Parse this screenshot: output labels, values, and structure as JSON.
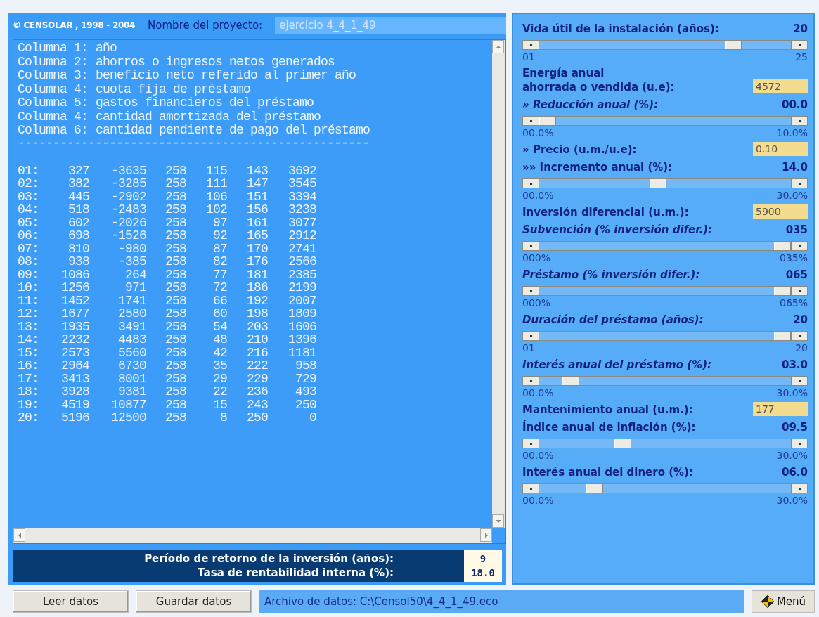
{
  "header": {
    "copyright": "© CENSOLAR , 1998 - 2004",
    "project_label": "Nombre del proyecto:",
    "project_name": "ejercicio 4_4_1_49"
  },
  "output": {
    "legend": [
      {
        "column": "Columna 1:",
        "text": "año"
      },
      {
        "column": "Columna 2:",
        "text": "ahorros o ingresos netos generados"
      },
      {
        "column": "Columna 3:",
        "text": "beneficio neto referido al primer año"
      },
      {
        "column": "Columna 4:",
        "text": "cuota fija de préstamo"
      },
      {
        "column": "Columna 5:",
        "text": "gastos financieros del préstamo"
      },
      {
        "column": "Columna 4:",
        "text": "cantidad amortizada del préstamo"
      },
      {
        "column": "Columna 6:",
        "text": "cantidad pendiente de pago del préstamo"
      }
    ],
    "separator": "--------------------------------------------------",
    "rows": [
      [
        "01:",
        "327",
        "-3635",
        "258",
        "115",
        "143",
        "3692"
      ],
      [
        "02:",
        "382",
        "-3285",
        "258",
        "111",
        "147",
        "3545"
      ],
      [
        "03:",
        "445",
        "-2902",
        "258",
        "106",
        "151",
        "3394"
      ],
      [
        "04:",
        "518",
        "-2483",
        "258",
        "102",
        "156",
        "3238"
      ],
      [
        "05:",
        "602",
        "-2026",
        "258",
        "97",
        "161",
        "3077"
      ],
      [
        "06:",
        "698",
        "-1526",
        "258",
        "92",
        "165",
        "2912"
      ],
      [
        "07:",
        "810",
        "-980",
        "258",
        "87",
        "170",
        "2741"
      ],
      [
        "08:",
        "938",
        "-385",
        "258",
        "82",
        "176",
        "2566"
      ],
      [
        "09:",
        "1086",
        "264",
        "258",
        "77",
        "181",
        "2385"
      ],
      [
        "10:",
        "1256",
        "971",
        "258",
        "72",
        "186",
        "2199"
      ],
      [
        "11:",
        "1452",
        "1741",
        "258",
        "66",
        "192",
        "2007"
      ],
      [
        "12:",
        "1677",
        "2580",
        "258",
        "60",
        "198",
        "1809"
      ],
      [
        "13:",
        "1935",
        "3491",
        "258",
        "54",
        "203",
        "1606"
      ],
      [
        "14:",
        "2232",
        "4483",
        "258",
        "48",
        "210",
        "1396"
      ],
      [
        "15:",
        "2573",
        "5560",
        "258",
        "42",
        "216",
        "1181"
      ],
      [
        "16:",
        "2964",
        "6730",
        "258",
        "35",
        "222",
        "958"
      ],
      [
        "17:",
        "3413",
        "8001",
        "258",
        "29",
        "229",
        "729"
      ],
      [
        "18:",
        "3928",
        "9381",
        "258",
        "22",
        "236",
        "493"
      ],
      [
        "19:",
        "4519",
        "10877",
        "258",
        "15",
        "243",
        "250"
      ],
      [
        "20:",
        "5196",
        "12500",
        "258",
        "8",
        "250",
        "0"
      ]
    ]
  },
  "results": [
    {
      "label": "Período de retorno de la inversión (años):",
      "value": "9"
    },
    {
      "label": "Tasa de rentabilidad interna (%):",
      "value": "18.0"
    }
  ],
  "parameters": [
    {
      "kind": "slider",
      "label": "Vida útil de la instalación (años):",
      "italic": false,
      "value": "20",
      "level": 0.79,
      "min": "01",
      "max": "25"
    },
    {
      "kind": "input",
      "label": "Energía anual\nahorrada o vendida (u.e):",
      "italic": false,
      "value": "4572"
    },
    {
      "kind": "slider",
      "label": "» Reducción anual (%):",
      "italic": true,
      "value": "00.0",
      "level": 0,
      "min": "00.0%",
      "max": "10.0%"
    },
    {
      "kind": "input",
      "label": "» Precio (u.m./u.e):",
      "italic": false,
      "value": "0.10"
    },
    {
      "kind": "slider",
      "label": "»» Incremento anual (%):",
      "italic": false,
      "value": "14.0",
      "level": 0.47,
      "min": "00.0%",
      "max": "30.0%"
    },
    {
      "kind": "input",
      "label": "Inversión diferencial (u.m.):",
      "italic": false,
      "value": "5900"
    },
    {
      "kind": "slider",
      "label": "Subvención (% inversión difer.):",
      "italic": true,
      "value": "035",
      "level": 1,
      "min": "000%",
      "max": "035%"
    },
    {
      "kind": "slider",
      "label": "Préstamo (% inversión difer.):",
      "italic": true,
      "value": "065",
      "level": 1,
      "min": "000%",
      "max": "065%"
    },
    {
      "kind": "slider",
      "label": "Duración del préstamo (años):",
      "italic": true,
      "value": "20",
      "level": 1,
      "min": "01",
      "max": "20"
    },
    {
      "kind": "slider",
      "label": "Interés anual del préstamo (%):",
      "italic": true,
      "value": "03.0",
      "level": 0.1,
      "min": "00.0%",
      "max": "30.0%"
    },
    {
      "kind": "input",
      "label": "Mantenimiento anual (u.m.):",
      "italic": false,
      "value": "177"
    },
    {
      "kind": "slider",
      "label": "Índice anual de inflación (%):",
      "italic": false,
      "value": "09.5",
      "level": 0.32,
      "min": "00.0%",
      "max": "30.0%"
    },
    {
      "kind": "slider",
      "label": "Interés anual del dinero (%):",
      "italic": false,
      "value": "06.0",
      "level": 0.2,
      "min": "00.0%",
      "max": "30.0%"
    }
  ],
  "footer": {
    "buttons": [
      "Leer datos",
      "Guardar datos"
    ],
    "file_path": "Archivo de datos: C:\\Censol50\\4_4_1_49.eco",
    "menu": "Menú"
  }
}
